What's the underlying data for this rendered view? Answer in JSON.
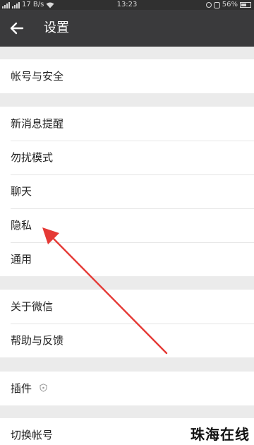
{
  "status_bar": {
    "network": "17 B/s",
    "time": "13:23",
    "battery": "56%"
  },
  "header": {
    "title": "设置",
    "back_icon": "arrow-left-icon"
  },
  "groups": [
    {
      "items": [
        {
          "label": "帐号与安全"
        }
      ]
    },
    {
      "items": [
        {
          "label": "新消息提醒"
        },
        {
          "label": "勿扰模式"
        },
        {
          "label": "聊天"
        },
        {
          "label": "隐私"
        },
        {
          "label": "通用"
        }
      ]
    },
    {
      "items": [
        {
          "label": "关于微信"
        },
        {
          "label": "帮助与反馈"
        }
      ]
    },
    {
      "items": [
        {
          "label": "插件",
          "icon": "shield-icon"
        }
      ]
    },
    {
      "items": [
        {
          "label": "切换帐号"
        }
      ]
    }
  ],
  "annotation": {
    "color": "#e53935",
    "points_to": "隐私"
  },
  "watermark": "珠海在线",
  "colors": {
    "title_bar": "#3a3a3c",
    "status_bar": "#303030",
    "background": "#ebebeb",
    "row_background": "#ffffff"
  }
}
